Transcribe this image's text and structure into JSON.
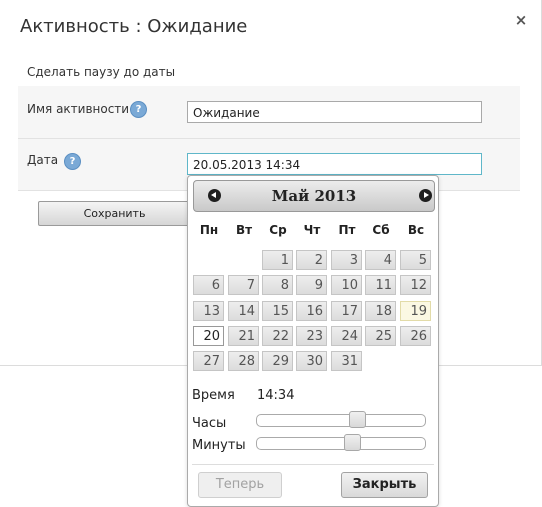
{
  "dialog": {
    "title": "Активность : Ожидание",
    "close_icon": "×",
    "subtitle": "Сделать паузу до даты",
    "help_glyph": "?",
    "fields": [
      {
        "label": "Имя активности",
        "value": "Ожидание"
      },
      {
        "label": "Дата",
        "value": "20.05.2013 14:34"
      }
    ],
    "save_label": "Сохранить"
  },
  "datepicker": {
    "month_title": "Май 2013",
    "weekdays": [
      "Пн",
      "Вт",
      "Ср",
      "Чт",
      "Пт",
      "Сб",
      "Вс"
    ],
    "days": [
      "1",
      "2",
      "3",
      "4",
      "5",
      "6",
      "7",
      "8",
      "9",
      "10",
      "11",
      "12",
      "13",
      "14",
      "15",
      "16",
      "17",
      "18",
      "19",
      "20",
      "21",
      "22",
      "23",
      "24",
      "25",
      "26",
      "27",
      "28",
      "29",
      "30",
      "31"
    ],
    "first_weekday_index": 2,
    "today": "19",
    "selected": "20",
    "time_label": "Время",
    "time_value": "14:34",
    "hours_label": "Часы",
    "minutes_label": "Минуты",
    "hours": 14,
    "minutes": 34,
    "now_label": "Теперь",
    "close_label": "Закрыть"
  },
  "colors": {
    "today_bg": "#fbf8e3",
    "active_input_border": "#5fb7c9",
    "help_icon": "#7aa9d6"
  }
}
